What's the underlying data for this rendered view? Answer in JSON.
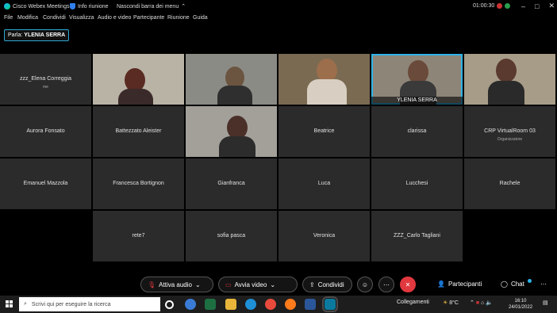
{
  "app": {
    "title": "Cisco Webex Meetings",
    "meeting_info": "Info riunione",
    "hide_menu": "Nascondi barra dei menu",
    "timer": "01:00:30"
  },
  "menu": [
    "File",
    "Modifica",
    "Condividi",
    "Visualizza",
    "Audio e video",
    "Partecipante",
    "Riunione",
    "Guida"
  ],
  "speaking": {
    "label": "Parla:",
    "name": "YLENIA SERRA"
  },
  "participants": [
    {
      "name": "zzz_Elena Correggia",
      "sub": "me",
      "video": false
    },
    {
      "name": "",
      "video": true
    },
    {
      "name": "",
      "video": true
    },
    {
      "name": "",
      "video": true
    },
    {
      "name": "YLENIA SERRA",
      "video": true,
      "active": true
    },
    {
      "name": "",
      "video": true
    },
    {
      "name": "Aurora Fonsato",
      "video": false
    },
    {
      "name": "Battezzato Aleister",
      "video": false
    },
    {
      "name": "",
      "video": true
    },
    {
      "name": "Beatrice",
      "video": false
    },
    {
      "name": "clarissa",
      "video": false
    },
    {
      "name": "CRP VirtualRoom 03",
      "sub": "Organizzatore",
      "video": false
    },
    {
      "name": "Emanuel Mazzola",
      "video": false
    },
    {
      "name": "Francesca Bortignon",
      "video": false
    },
    {
      "name": "Gianfranca",
      "video": false
    },
    {
      "name": "Luca",
      "video": false
    },
    {
      "name": "Lucchesi",
      "video": false
    },
    {
      "name": "Rachele",
      "video": false
    },
    {
      "name": "rete7",
      "video": false
    },
    {
      "name": "sofia pasca",
      "video": false
    },
    {
      "name": "Veronica",
      "video": false
    },
    {
      "name": "ZZZ_Carlo Tagliani",
      "video": false
    }
  ],
  "controls": {
    "audio": "Attiva audio",
    "video": "Avvia video",
    "share": "Condividi",
    "participants": "Partecipanti",
    "chat": "Chat"
  },
  "taskbar": {
    "search_placeholder": "Scrivi qui per eseguire la ricerca",
    "network": "Collegamenti",
    "weather": "8°C",
    "time": "16:10",
    "date": "24/01/2022"
  },
  "colors": {
    "accent": "#2fb3e8",
    "end_call": "#e0383e",
    "tile": "#2b2b2b"
  }
}
